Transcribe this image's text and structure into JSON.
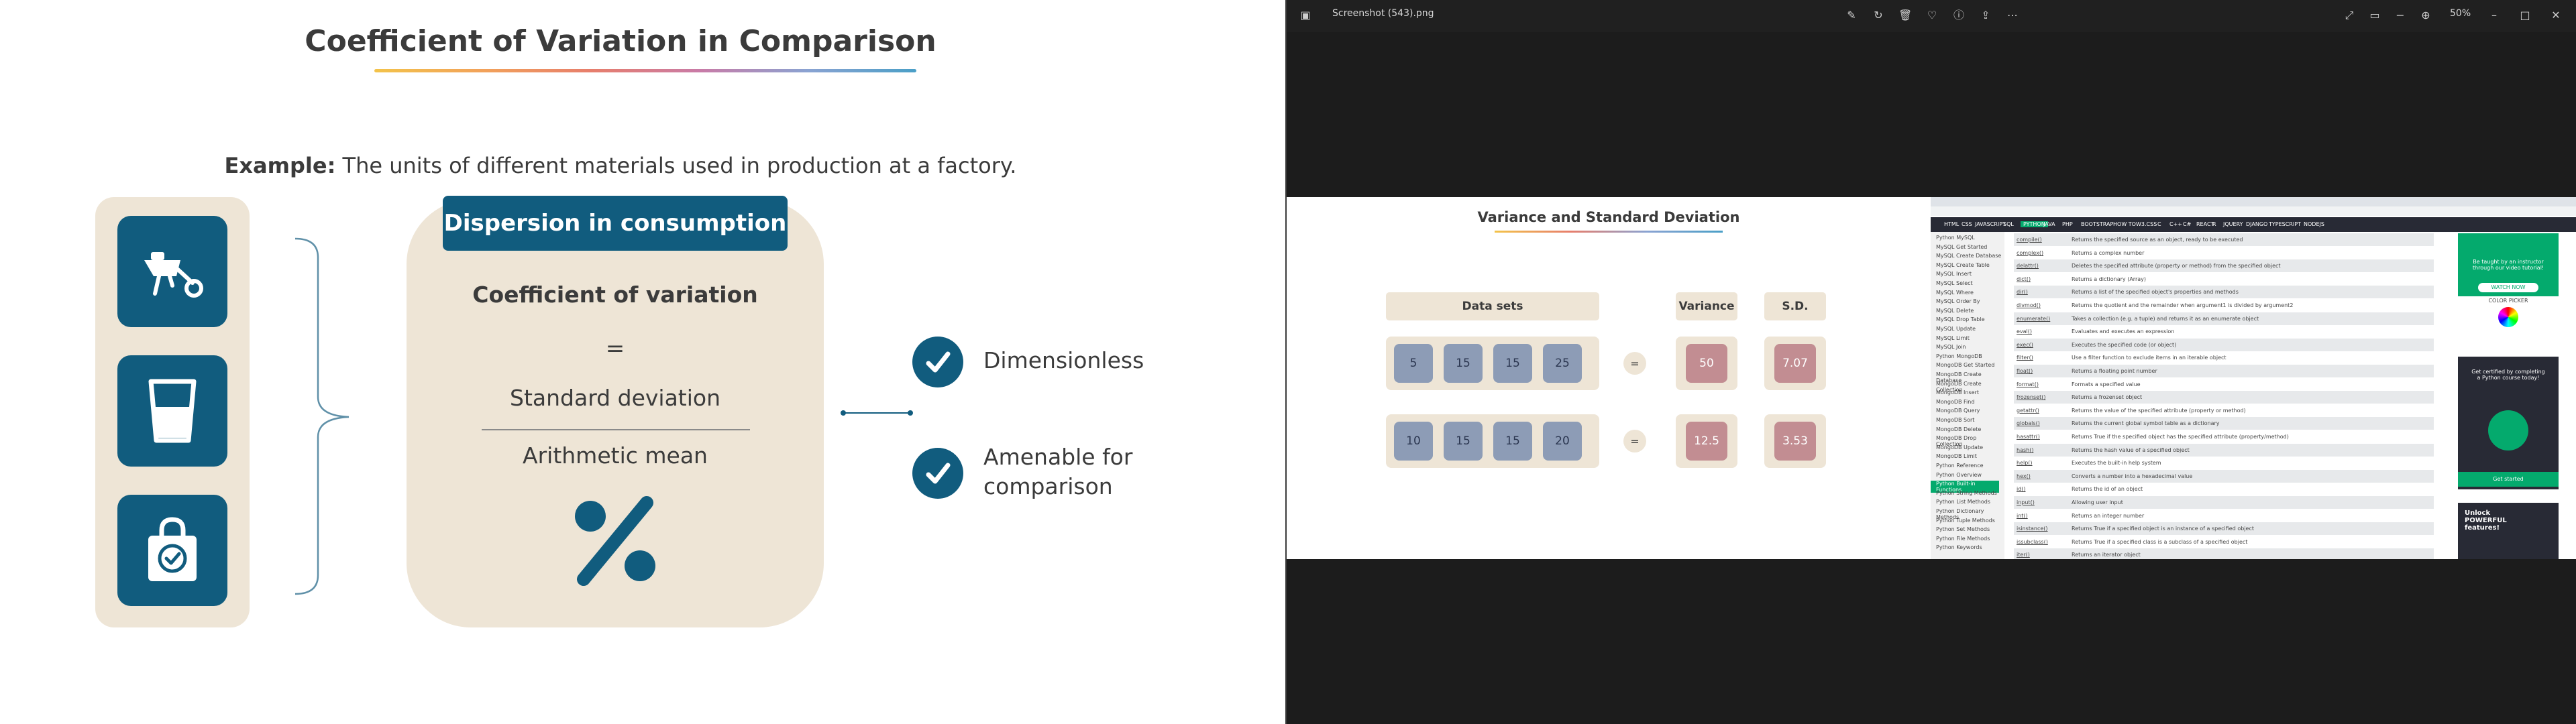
{
  "slide": {
    "title": "Coefficient of Variation in Comparison",
    "example_label": "Example:",
    "example_text": " The units of different materials used in production at a factory.",
    "icons": [
      "wheelbarrow-icon",
      "water-glass-icon",
      "shopping-bag-check-icon"
    ],
    "header": "Dispersion in consumption",
    "cov_title": "Coefficient of variation",
    "equals": "=",
    "numerator": "Standard deviation",
    "denominator": "Arithmetic mean",
    "percent_icon": "percent-icon",
    "attributes": [
      {
        "icon": "check-circle-icon",
        "lines": [
          "Dimensionless"
        ]
      },
      {
        "icon": "check-circle-icon",
        "lines": [
          "Amenable for",
          "comparison"
        ]
      }
    ],
    "colors": {
      "primary": "#115c7e",
      "panel": "#eee5d6",
      "text": "#3b3b3b"
    }
  },
  "viewer": {
    "filename": "Screenshot (543).png",
    "zoom": "50%",
    "inner_slide": {
      "title": "Variance and Standard Deviation",
      "headers": [
        "Data sets",
        "Variance",
        "S.D."
      ],
      "equals_symbol": "=",
      "rows": [
        {
          "values": [
            "5",
            "15",
            "15",
            "25"
          ],
          "variance": "50",
          "sd": "7.07"
        },
        {
          "values": [
            "10",
            "15",
            "15",
            "20"
          ],
          "variance": "12.5",
          "sd": "3.53"
        }
      ]
    },
    "browser": {
      "nav": [
        "HTML",
        "CSS",
        "JAVASCRIPT",
        "SQL",
        "PYTHON",
        "JAVA",
        "PHP",
        "BOOTSTRAP",
        "HOW TO",
        "W3.CSS",
        "C",
        "C++",
        "C#",
        "REACT",
        "R",
        "JQUERY",
        "DJANGO",
        "TYPESCRIPT",
        "NODEJS"
      ],
      "sidebar": [
        "Python MySQL",
        "MySQL Get Started",
        "MySQL Create Database",
        "MySQL Create Table",
        "MySQL Insert",
        "MySQL Select",
        "MySQL Where",
        "MySQL Order By",
        "MySQL Delete",
        "MySQL Drop Table",
        "MySQL Update",
        "MySQL Limit",
        "MySQL Join",
        "Python MongoDB",
        "MongoDB Get Started",
        "MongoDB Create Database",
        "MongoDB Create Collection",
        "MongoDB Insert",
        "MongoDB Find",
        "MongoDB Query",
        "MongoDB Sort",
        "MongoDB Delete",
        "MongoDB Drop Collection",
        "MongoDB Update",
        "MongoDB Limit",
        "Python Reference",
        "Python Overview",
        "Python Built-in Functions",
        "Python String Methods",
        "Python List Methods",
        "Python Dictionary Methods",
        "Python Tuple Methods",
        "Python Set Methods",
        "Python File Methods",
        "Python Keywords"
      ],
      "functions": [
        {
          "fn": "compile()",
          "desc": "Returns the specified source as an object, ready to be executed"
        },
        {
          "fn": "complex()",
          "desc": "Returns a complex number"
        },
        {
          "fn": "delattr()",
          "desc": "Deletes the specified attribute (property or method) from the specified object"
        },
        {
          "fn": "dict()",
          "desc": "Returns a dictionary (Array)"
        },
        {
          "fn": "dir()",
          "desc": "Returns a list of the specified object's properties and methods"
        },
        {
          "fn": "divmod()",
          "desc": "Returns the quotient and the remainder when argument1 is divided by argument2"
        },
        {
          "fn": "enumerate()",
          "desc": "Takes a collection (e.g. a tuple) and returns it as an enumerate object"
        },
        {
          "fn": "eval()",
          "desc": "Evaluates and executes an expression"
        },
        {
          "fn": "exec()",
          "desc": "Executes the specified code (or object)"
        },
        {
          "fn": "filter()",
          "desc": "Use a filter function to exclude items in an iterable object"
        },
        {
          "fn": "float()",
          "desc": "Returns a floating point number"
        },
        {
          "fn": "format()",
          "desc": "Formats a specified value"
        },
        {
          "fn": "frozenset()",
          "desc": "Returns a frozenset object"
        },
        {
          "fn": "getattr()",
          "desc": "Returns the value of the specified attribute (property or method)"
        },
        {
          "fn": "globals()",
          "desc": "Returns the current global symbol table as a dictionary"
        },
        {
          "fn": "hasattr()",
          "desc": "Returns True if the specified object has the specified attribute (property/method)"
        },
        {
          "fn": "hash()",
          "desc": "Returns the hash value of a specified object"
        },
        {
          "fn": "help()",
          "desc": "Executes the built-in help system"
        },
        {
          "fn": "hex()",
          "desc": "Converts a number into a hexadecimal value"
        },
        {
          "fn": "id()",
          "desc": "Returns the id of an object"
        },
        {
          "fn": "input()",
          "desc": "Allowing user input"
        },
        {
          "fn": "int()",
          "desc": "Returns an integer number"
        },
        {
          "fn": "isinstance()",
          "desc": "Returns True if a specified object is an instance of a specified object"
        },
        {
          "fn": "issubclass()",
          "desc": "Returns True if a specified class is a subclass of a specified object"
        },
        {
          "fn": "iter()",
          "desc": "Returns an iterator object"
        }
      ],
      "ads": {
        "ad1": "Be taught by an instructor through our video tutorial!",
        "watch": "WATCH NOW",
        "color_picker": "COLOR PICKER",
        "ad2": "Get certified by completing a Python course today!",
        "get_started": "Get started",
        "ad3": "Unlock POWERFUL features!"
      }
    }
  }
}
